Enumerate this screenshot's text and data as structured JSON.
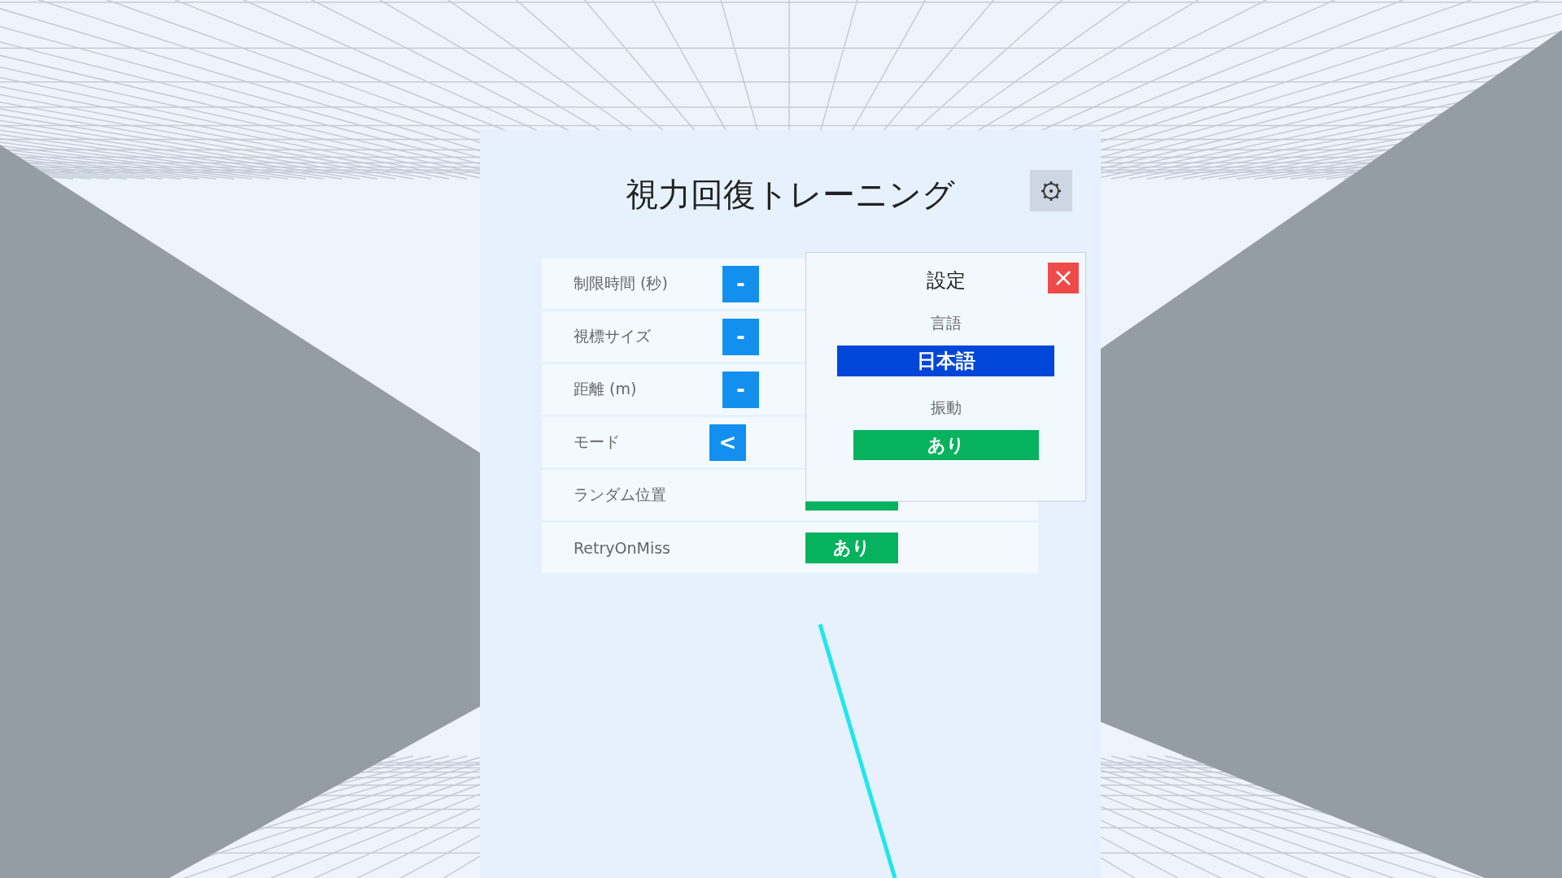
{
  "title": "視力回復トレーニング",
  "settings_rows": [
    {
      "kind": "stepper",
      "label": "制限時間 (秒)",
      "button": "-"
    },
    {
      "kind": "stepper",
      "label": "視標サイズ",
      "button": "-"
    },
    {
      "kind": "stepper",
      "label": "距離 (m)",
      "button": "-"
    },
    {
      "kind": "selector",
      "label": "モード",
      "button": "<"
    },
    {
      "kind": "toggle",
      "label": "ランダム位置",
      "on": true
    },
    {
      "kind": "toggle",
      "label": "RetryOnMiss",
      "on": true,
      "toggle": "あり"
    }
  ],
  "settings_dialog": {
    "title": "設定",
    "language_label": "言語",
    "language": "日本語",
    "vibration_label": "振動",
    "vibration": "あり",
    "vibration_on": true
  }
}
